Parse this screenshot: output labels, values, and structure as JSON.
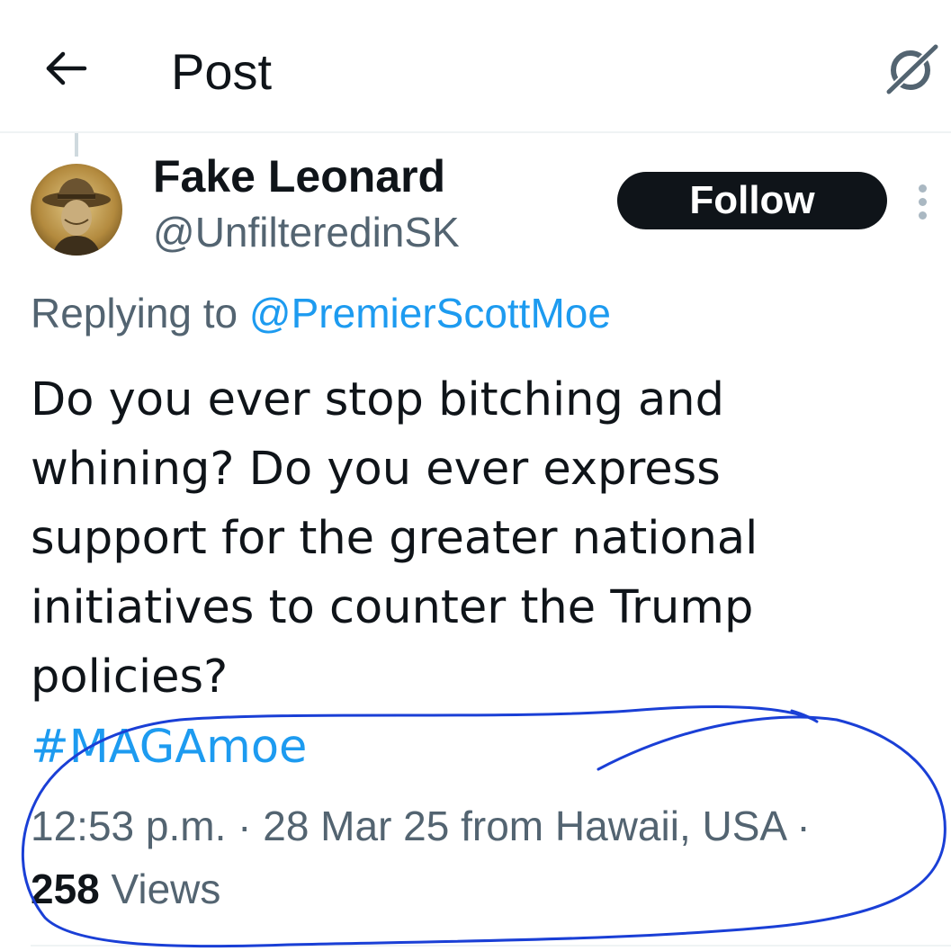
{
  "header": {
    "title": "Post",
    "back_icon": "arrow-left-icon",
    "grok_icon": "grok-icon"
  },
  "author": {
    "display_name": "Fake Leonard",
    "handle": "@UnfilteredinSK",
    "avatar_icon": "avatar-photo"
  },
  "follow_label": "Follow",
  "more_icon": "more-vertical-icon",
  "reply": {
    "prefix": "Replying to ",
    "mention": "@PremierScottMoe"
  },
  "tweet": {
    "text": "Do you ever stop bitching and\nwhining? Do you ever express\nsupport for the greater national\ninitiatives to counter the Trump\npolicies?",
    "hashtag": "#MAGAmoe"
  },
  "meta": {
    "line": "12:53 p.m. · 28 Mar 25 from Hawaii, USA ·",
    "views_count": "258",
    "views_label": " Views"
  },
  "colors": {
    "text": "#0f1419",
    "secondary": "#536471",
    "link": "#1d9bf0",
    "annotation": "#1a3fd6"
  }
}
